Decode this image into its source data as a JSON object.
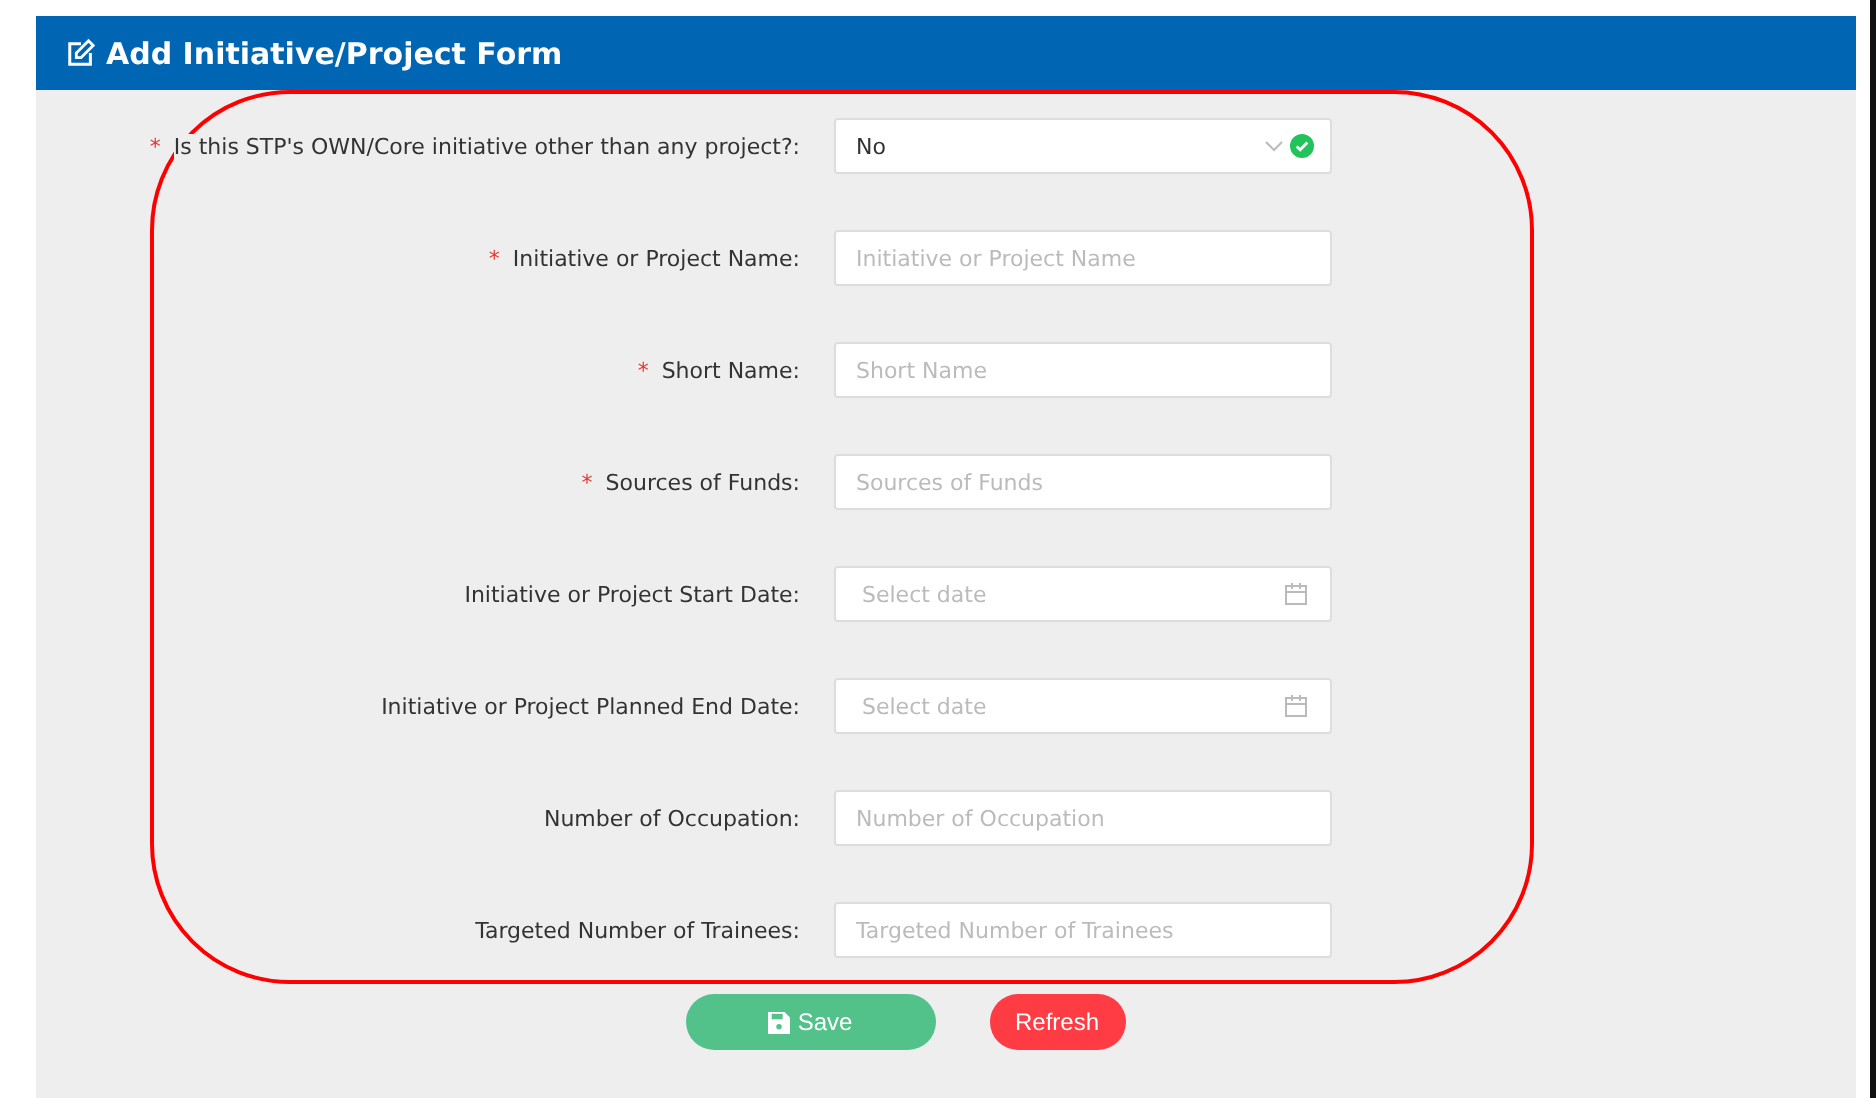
{
  "form": {
    "title": "Add Initiative/Project Form",
    "fields": [
      {
        "kind": "select",
        "label": "Is this STP's OWN/Core initiative other than any project?:",
        "required_mark": "*",
        "value": "No",
        "valid": true
      },
      {
        "kind": "text",
        "label": "Initiative or Project Name:",
        "required_mark": "*",
        "placeholder": "Initiative or Project Name"
      },
      {
        "kind": "text",
        "label": "Short Name:",
        "required_mark": "*",
        "placeholder": "Short Name"
      },
      {
        "kind": "text",
        "label": "Sources of Funds:",
        "required_mark": "*",
        "placeholder": "Sources of Funds"
      },
      {
        "kind": "date",
        "label": "Initiative or Project Start Date:",
        "placeholder": "Select date"
      },
      {
        "kind": "date",
        "label": "Initiative or Project Planned End Date:",
        "placeholder": "Select date"
      },
      {
        "kind": "text",
        "label": "Number of Occupation:",
        "placeholder": "Number of Occupation"
      },
      {
        "kind": "text",
        "label": "Targeted Number of Trainees:",
        "placeholder": "Targeted Number of Trainees"
      }
    ],
    "buttons": [
      {
        "kind": "save",
        "label": "Save"
      },
      {
        "kind": "refresh",
        "label": "Refresh"
      }
    ]
  },
  "annotation": {
    "kind": "outline"
  }
}
